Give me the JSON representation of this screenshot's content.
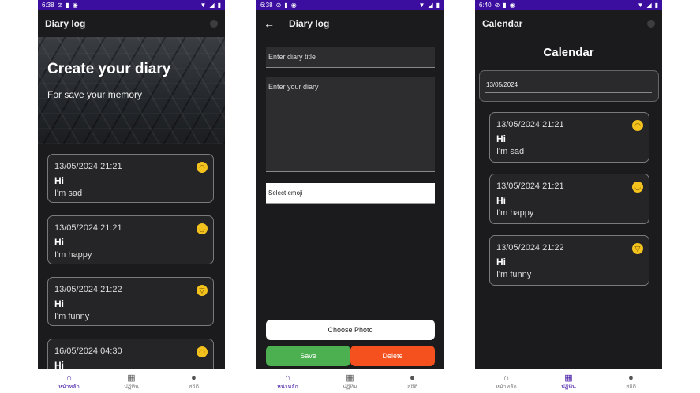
{
  "status": {
    "screen1_time": "6:38",
    "screen2_time": "6:38",
    "screen3_time": "6:40"
  },
  "screen1": {
    "title": "Diary log",
    "hero_title": "Create your diary",
    "hero_subtitle": "For save your memory",
    "entries": [
      {
        "time": "13/05/2024 21:21",
        "title": "Hi",
        "body": "I'm sad",
        "emoji": "sad-face-icon"
      },
      {
        "time": "13/05/2024 21:21",
        "title": "Hi",
        "body": "I'm happy",
        "emoji": "smile-face-icon"
      },
      {
        "time": "13/05/2024 21:22",
        "title": "Hi",
        "body": "I'm funny",
        "emoji": "laugh-face-icon"
      },
      {
        "time": "16/05/2024 04:30",
        "title": "Hi",
        "body": "",
        "emoji": "sad-face-icon"
      }
    ]
  },
  "screen2": {
    "title": "Diary log",
    "title_placeholder": "Enter diary title",
    "diary_placeholder": "Enter your diary",
    "select_emoji": "Select emoji",
    "choose_photo": "Choose Photo",
    "save": "Save",
    "delete": "Delete"
  },
  "screen3": {
    "title": "Calendar",
    "heading": "Calendar",
    "date": "13/05/2024",
    "entries": [
      {
        "time": "13/05/2024 21:21",
        "title": "Hi",
        "body": "I'm sad",
        "emoji": "sad-face-icon"
      },
      {
        "time": "13/05/2024 21:21",
        "title": "Hi",
        "body": "I'm happy",
        "emoji": "smile-face-icon"
      },
      {
        "time": "13/05/2024 21:22",
        "title": "Hi",
        "body": "I'm funny",
        "emoji": "laugh-face-icon"
      }
    ]
  },
  "nav": {
    "home": "หน้าหลัก",
    "calendar": "ปฏิทิน",
    "stats": "สถิติ"
  },
  "colors": {
    "accent": "#3b0ea0",
    "save": "#4caf50",
    "delete": "#f4511e",
    "emoji": "#f4c21c"
  }
}
